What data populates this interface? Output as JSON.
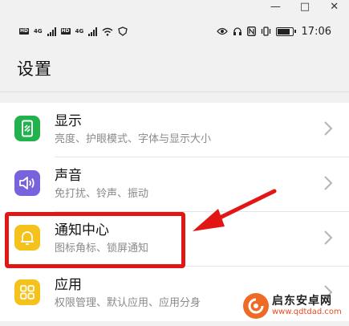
{
  "window": {
    "minimize": "—",
    "maximize": "□",
    "close": "✕"
  },
  "status_bar": {
    "sim1_tag": "HD",
    "sim1_net": "4G",
    "sim2_tag": "HD",
    "sim2_net": "4G",
    "wifi_icon": "wifi-icon",
    "battery_level": 0.85,
    "time": "17:06"
  },
  "header": {
    "title": "设置"
  },
  "settings": [
    {
      "title": "显示",
      "subtitle": "亮度、护眼模式、字体与显示大小",
      "icon": "display-icon",
      "color": "#21b24b"
    },
    {
      "title": "声音",
      "subtitle": "免打扰、铃声、振动",
      "icon": "sound-icon",
      "color": "#7b62dd"
    },
    {
      "title": "通知中心",
      "subtitle": "图标角标、锁屏通知",
      "icon": "bell-icon",
      "color": "#f5c21c"
    },
    {
      "title": "应用",
      "subtitle": "权限管理、默认应用、应用分身",
      "icon": "apps-icon",
      "color": "#f5c21c"
    }
  ],
  "annotation": {
    "color": "#e31616"
  },
  "watermark": {
    "title": "启东安卓网",
    "url": "www.qdtdad.com"
  }
}
